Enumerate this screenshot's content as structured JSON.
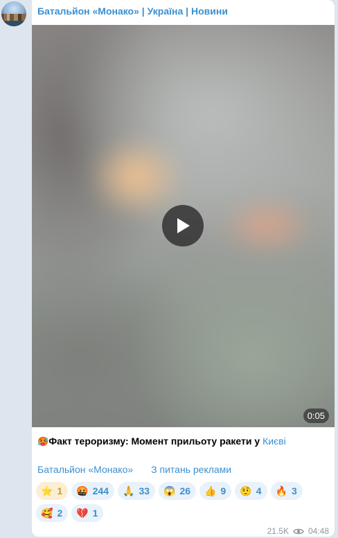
{
  "channel": {
    "name": "Батальйон «Монако» | Україна | Новини"
  },
  "video": {
    "duration": "0:05"
  },
  "caption": {
    "emoji": "🥵",
    "text": "Факт тероризму: Момент прильоту ракети у ",
    "link_text": "Києві"
  },
  "links": {
    "channel_link": "Батальйон «Монако»",
    "ads_link": "З питань реклами"
  },
  "reactions": [
    {
      "emoji": "⭐",
      "count": "1"
    },
    {
      "emoji": "🤬",
      "count": "244"
    },
    {
      "emoji": "🙏",
      "count": "33"
    },
    {
      "emoji": "😱",
      "count": "26"
    },
    {
      "emoji": "👍",
      "count": "9"
    },
    {
      "emoji": "🤨",
      "count": "4"
    },
    {
      "emoji": "🔥",
      "count": "3"
    },
    {
      "emoji": "🥰",
      "count": "2"
    },
    {
      "emoji": "💔",
      "count": "1"
    }
  ],
  "meta": {
    "views": "21.5K",
    "time": "04:48"
  },
  "colors": {
    "accent": "#3a8fd0",
    "background": "#dde6ee",
    "paid_reaction": "#fbefd3"
  }
}
